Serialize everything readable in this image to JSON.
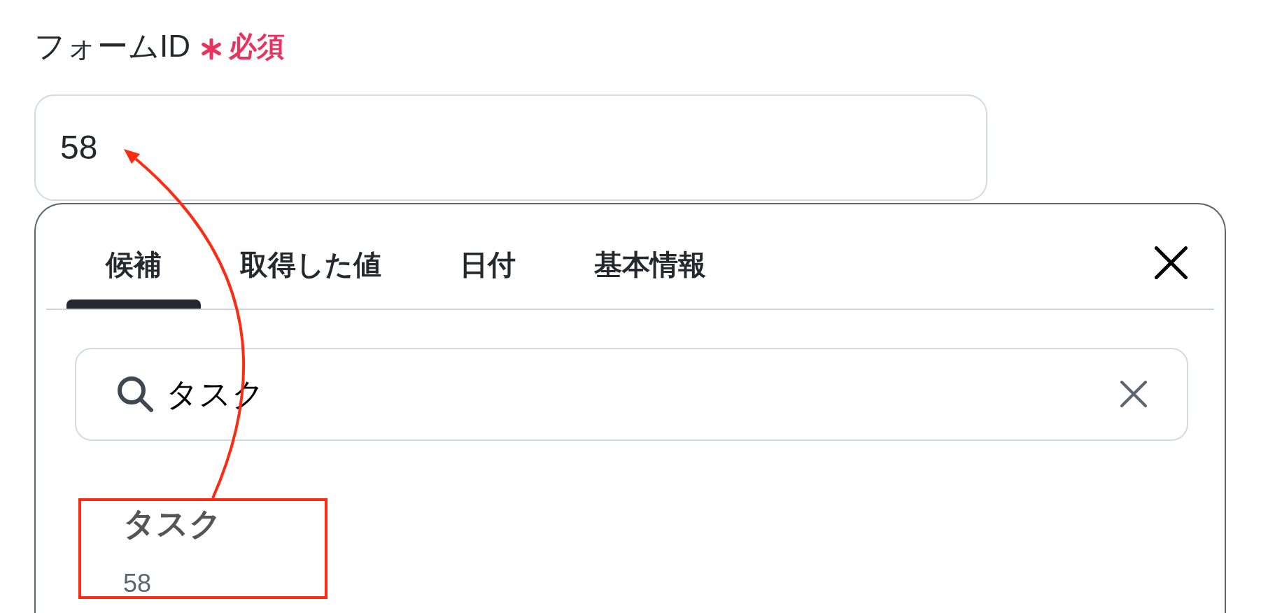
{
  "field": {
    "label": "フォームID",
    "required": true,
    "required_text": "必須",
    "value": "58"
  },
  "popup": {
    "tabs": [
      {
        "label": "候補",
        "selected": true
      },
      {
        "label": "取得した値",
        "selected": false
      },
      {
        "label": "日付",
        "selected": false
      },
      {
        "label": "基本情報",
        "selected": false
      }
    ],
    "search": {
      "value": "タスク"
    },
    "results": [
      {
        "title": "タスク",
        "subtitle": "58"
      }
    ]
  }
}
